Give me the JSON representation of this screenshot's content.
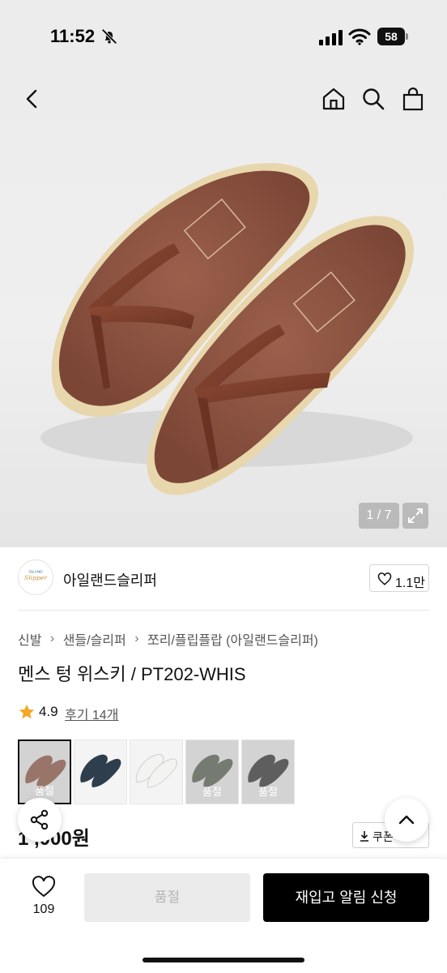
{
  "status_bar": {
    "time": "11:52",
    "battery": "58",
    "icons": [
      "bell-slash-icon",
      "signal-icon",
      "wifi-icon",
      "battery-icon"
    ]
  },
  "top_nav": {
    "icons": [
      "back-arrow-icon",
      "home-icon",
      "search-icon",
      "shopping-bag-icon"
    ]
  },
  "hero": {
    "image_counter": "1 / 7",
    "product_colors": {
      "strap": "#7a3e2b",
      "footbed": "#8a5442",
      "sole": "#e8d6ad"
    }
  },
  "brand": {
    "name": "아일랜드슬리퍼",
    "likes": "1.1만"
  },
  "breadcrumb": [
    "신발",
    "샌들/슬리퍼",
    "쪼리/플립플랍 (아일랜드슬리퍼)"
  ],
  "product": {
    "title": "멘스 텅 위스키 / PT202-WHIS",
    "rating": "4.9",
    "review_label": "후기 14개",
    "price": "1 ,000원"
  },
  "color_options": [
    {
      "color": "#8a4a34",
      "selected": true,
      "soldout": true,
      "label": "품절"
    },
    {
      "color": "#2f3e4c",
      "selected": false,
      "soldout": false,
      "label": ""
    },
    {
      "color": "#f3f3f1",
      "selected": false,
      "soldout": false,
      "label": ""
    },
    {
      "color": "#4c5443",
      "selected": false,
      "soldout": true,
      "label": "품절"
    },
    {
      "color": "#1f1f1f",
      "selected": false,
      "soldout": true,
      "label": "품절"
    }
  ],
  "coupon_button": "쿠폰",
  "bottom_bar": {
    "wish_count": "109",
    "soldout_button": "품절",
    "restock_button": "재입고 알림 신청"
  },
  "colors": {
    "accent": "#000000",
    "star": "#f5a623"
  }
}
